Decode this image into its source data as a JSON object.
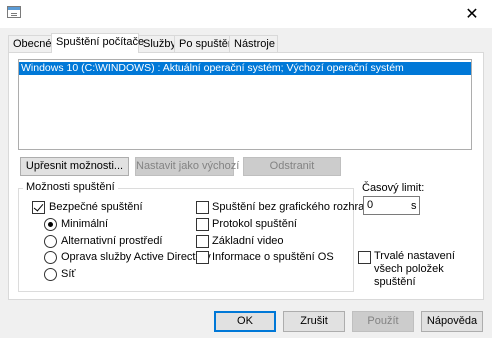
{
  "window": {
    "title": "",
    "close_glyph": "✕"
  },
  "tabs": [
    {
      "label": "Obecné"
    },
    {
      "label": "Spuštění počítače"
    },
    {
      "label": "Služby"
    },
    {
      "label": "Po spuštění"
    },
    {
      "label": "Nástroje"
    }
  ],
  "active_tab": "Spuštění počítače",
  "os_list": {
    "items": [
      {
        "label": "Windows 10 (C:\\WINDOWS) : Aktuální operační systém; Výchozí operační systém",
        "selected": true
      }
    ]
  },
  "list_buttons": {
    "advanced": "Upřesnit možnosti...",
    "set_default": "Nastavit jako výchozí",
    "delete": "Odstranit"
  },
  "boot_options": {
    "legend": "Možnosti spuštění",
    "safe_boot": {
      "label": "Bezpečné spuštění",
      "checked": true
    },
    "minimal": {
      "label": "Minimální",
      "checked": true
    },
    "alternate_shell": {
      "label": "Alternativní prostředí",
      "checked": false
    },
    "ad_repair": {
      "label": "Oprava služby Active Directory",
      "checked": false
    },
    "network": {
      "label": "Síť",
      "checked": false
    },
    "no_gui_boot": {
      "label": "Spuštění bez grafického rozhraní",
      "checked": false
    },
    "boot_log": {
      "label": "Protokol spuštění",
      "checked": false
    },
    "base_video": {
      "label": "Základní video",
      "checked": false
    },
    "os_boot_info": {
      "label": "Informace o spuštění OS",
      "checked": false
    }
  },
  "timeout": {
    "label": "Časový limit:",
    "value": "0",
    "unit": "s"
  },
  "persistent": {
    "label": "Trvalé nastavení všech položek spuštění",
    "checked": false
  },
  "footer": {
    "ok": "OK",
    "cancel": "Zrušit",
    "apply": "Použít",
    "help": "Nápověda"
  },
  "colors": {
    "selection": "#0078d7",
    "window_bg": "#f0f0f0",
    "panel_bg": "#ffffff"
  }
}
